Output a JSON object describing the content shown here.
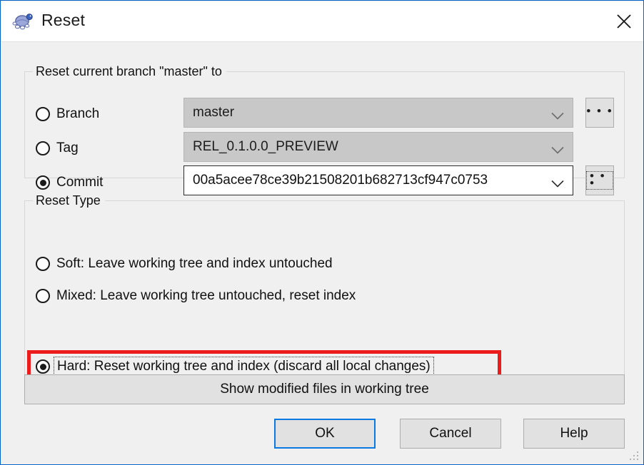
{
  "window": {
    "title": "Reset",
    "icon": "tortoisegit-turtle-icon",
    "close_label": "✕",
    "accent_border": "#0a64c8"
  },
  "source_group": {
    "label": "Reset current branch \"master\" to",
    "options": [
      {
        "id": "branch",
        "label": "Branch",
        "checked": false,
        "value": "master",
        "enabled": false,
        "browse_label": "• • •",
        "browse_focused": false
      },
      {
        "id": "tag",
        "label": "Tag",
        "checked": false,
        "value": "REL_0.1.0.0_PREVIEW",
        "enabled": false,
        "browse_label": null,
        "browse_focused": false
      },
      {
        "id": "commit",
        "label": "Commit",
        "checked": true,
        "value": "00a5acee78ce39b21508201b682713cf947c0753",
        "enabled": true,
        "browse_label": "• • •",
        "browse_focused": true
      }
    ]
  },
  "reset_type_group": {
    "label": "Reset Type",
    "options": [
      {
        "id": "soft",
        "label": "Soft: Leave working tree and index untouched",
        "checked": false,
        "focused": false,
        "highlighted": false
      },
      {
        "id": "mixed",
        "label": "Mixed: Leave working tree untouched, reset index",
        "checked": false,
        "focused": false,
        "highlighted": false
      },
      {
        "id": "hard",
        "label": "Hard: Reset working tree and index (discard all local changes)",
        "checked": true,
        "focused": true,
        "highlighted": true
      }
    ],
    "highlight_color": "#ec1c1c"
  },
  "actions": {
    "show_modified": "Show modified files in working tree",
    "ok": "OK",
    "cancel": "Cancel",
    "help": "Help"
  }
}
